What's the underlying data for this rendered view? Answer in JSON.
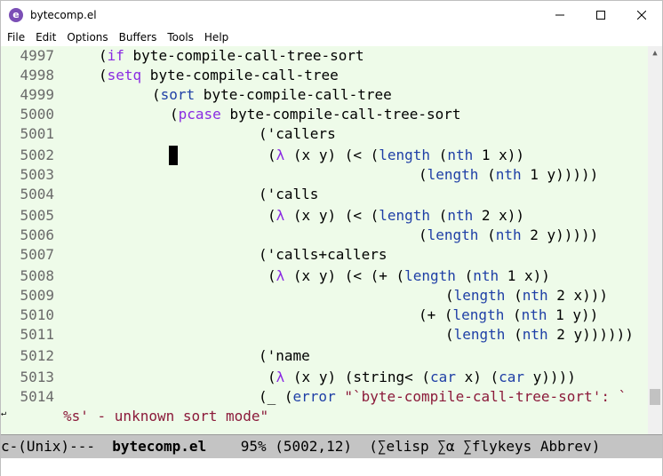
{
  "window": {
    "title": "bytecomp.el",
    "icon": "emacs-icon",
    "controls": [
      "minimize-icon",
      "maximize-icon",
      "close-icon"
    ]
  },
  "menu": [
    "File",
    "Edit",
    "Options",
    "Buffers",
    "Tools",
    "Help"
  ],
  "lines": [
    {
      "num": "4997",
      "parts": [
        [
          "p",
          "(",
          "0"
        ],
        [
          "k",
          "if"
        ],
        [
          "p",
          " byte-compile-call-tree-sort"
        ]
      ]
    },
    {
      "num": "4998",
      "parts": [
        [
          "p",
          "("
        ],
        [
          "k",
          "setq"
        ],
        [
          "p",
          " byte-compile-call-tree"
        ]
      ]
    },
    {
      "num": "4999",
      "parts": [
        [
          "p",
          "("
        ],
        [
          "f",
          "sort"
        ],
        [
          "p",
          " byte-compile-call-tree"
        ]
      ]
    },
    {
      "num": "5000",
      "parts": [
        [
          "p",
          "("
        ],
        [
          "k",
          "pcase"
        ],
        [
          "p",
          " byte-compile-call-tree-sort"
        ]
      ]
    },
    {
      "num": "5001",
      "parts": [
        [
          "p",
          "('callers"
        ]
      ]
    },
    {
      "num": "5002",
      "parts": [
        [
          "p",
          "("
        ],
        [
          "k",
          "λ"
        ],
        [
          "p",
          " (x y) (< ("
        ],
        [
          "f",
          "length"
        ],
        [
          "p",
          " ("
        ],
        [
          "f",
          "nth"
        ],
        [
          "p",
          " 1 x))"
        ]
      ]
    },
    {
      "num": "5003",
      "parts": [
        [
          "p",
          "("
        ],
        [
          "f",
          "length"
        ],
        [
          "p",
          " ("
        ],
        [
          "f",
          "nth"
        ],
        [
          "p",
          " 1 y)))))"
        ]
      ]
    },
    {
      "num": "5004",
      "parts": [
        [
          "p",
          "('calls"
        ]
      ]
    },
    {
      "num": "5005",
      "parts": [
        [
          "p",
          "("
        ],
        [
          "k",
          "λ"
        ],
        [
          "p",
          " (x y) (< ("
        ],
        [
          "f",
          "length"
        ],
        [
          "p",
          " ("
        ],
        [
          "f",
          "nth"
        ],
        [
          "p",
          " 2 x))"
        ]
      ]
    },
    {
      "num": "5006",
      "parts": [
        [
          "p",
          "("
        ],
        [
          "f",
          "length"
        ],
        [
          "p",
          " ("
        ],
        [
          "f",
          "nth"
        ],
        [
          "p",
          " 2 y)))))"
        ]
      ]
    },
    {
      "num": "5007",
      "parts": [
        [
          "p",
          "('calls+callers"
        ]
      ]
    },
    {
      "num": "5008",
      "parts": [
        [
          "p",
          "("
        ],
        [
          "k",
          "λ"
        ],
        [
          "p",
          " (x y) (< (+ ("
        ],
        [
          "f",
          "length"
        ],
        [
          "p",
          " ("
        ],
        [
          "f",
          "nth"
        ],
        [
          "p",
          " 1 x))"
        ]
      ]
    },
    {
      "num": "5009",
      "parts": [
        [
          "p",
          "("
        ],
        [
          "f",
          "length"
        ],
        [
          "p",
          " ("
        ],
        [
          "f",
          "nth"
        ],
        [
          "p",
          " 2 x)))"
        ]
      ]
    },
    {
      "num": "5010",
      "parts": [
        [
          "p",
          "(+ ("
        ],
        [
          "f",
          "length"
        ],
        [
          "p",
          " ("
        ],
        [
          "f",
          "nth"
        ],
        [
          "p",
          " 1 y))"
        ]
      ]
    },
    {
      "num": "5011",
      "parts": [
        [
          "p",
          "("
        ],
        [
          "f",
          "length"
        ],
        [
          "p",
          " ("
        ],
        [
          "f",
          "nth"
        ],
        [
          "p",
          " 2 y))))))"
        ]
      ]
    },
    {
      "num": "5012",
      "parts": [
        [
          "p",
          "('name"
        ]
      ]
    },
    {
      "num": "5013",
      "parts": [
        [
          "p",
          "("
        ],
        [
          "k",
          "λ"
        ],
        [
          "p",
          " (x y) (string< ("
        ],
        [
          "f",
          "car"
        ],
        [
          "p",
          " x) ("
        ],
        [
          "f",
          "car"
        ],
        [
          "p",
          " y))))"
        ]
      ]
    },
    {
      "num": "5014",
      "parts": [
        [
          "p",
          "(_ ("
        ],
        [
          "f",
          "error"
        ],
        [
          "p",
          " "
        ],
        [
          "s",
          "\"`byte-compile-call-tree-sort': `"
        ]
      ]
    },
    {
      "num": "",
      "parts": [
        [
          "s",
          "%s' - unknown sort mode\""
        ]
      ]
    }
  ],
  "modeline": {
    "prefix": "c-(Unix)---  ",
    "buffer": "bytecomp.el",
    "position": "    95% (5002,12)  ",
    "modes": "(∑elisp ∑α ∑flykeys Abbrev)"
  }
}
